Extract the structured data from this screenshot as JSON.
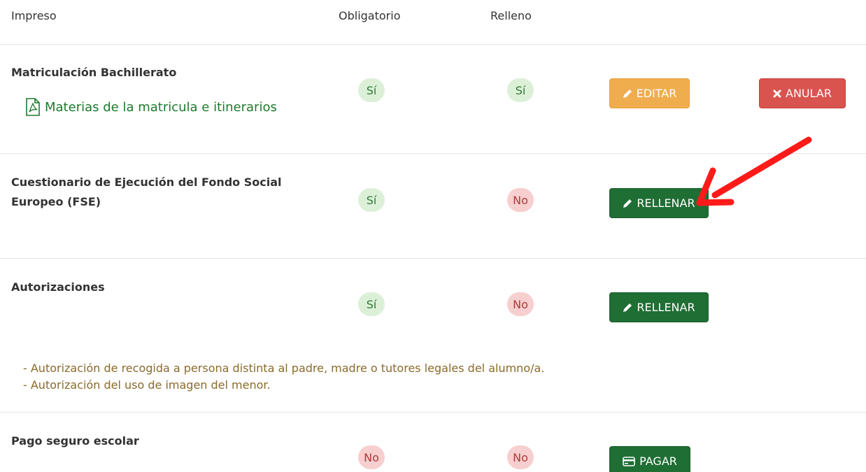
{
  "table": {
    "headers": {
      "impreso": "Impreso",
      "obligatorio": "Obligatorio",
      "relleno": "Relleno"
    },
    "rows": [
      {
        "title": "Matriculación Bachillerato",
        "link": "Materias de la matricula e itinerarios",
        "obligatorio": "Sí",
        "relleno": "Sí",
        "edit_label": "EDITAR",
        "cancel_label": "ANULAR"
      },
      {
        "title": "Cuestionario de Ejecución del Fondo Social Europeo (FSE)",
        "obligatorio": "Sí",
        "relleno": "No",
        "action_label": "RELLENAR"
      },
      {
        "title": "Autorizaciones",
        "obligatorio": "Sí",
        "relleno": "No",
        "action_label": "RELLENAR",
        "notes": [
          "- Autorización de recogida a persona distinta al padre, madre o tutores legales del alumno/a.",
          "- Autorización del uso de imagen del menor."
        ]
      },
      {
        "title": "Pago seguro escolar",
        "obligatorio": "No",
        "relleno": "No",
        "action_label": "PAGAR"
      }
    ]
  },
  "colors": {
    "yes_badge": "#dcf0d8",
    "no_badge": "#f7cfcf",
    "edit_button": "#f0ad4e",
    "cancel_button": "#d9534f",
    "fill_button": "#1f6e34",
    "link": "#1d7a2c",
    "note_text": "#8a6a2a",
    "annotation_arrow": "#ff1a1a"
  },
  "icons": {
    "pdf": "pdf-file-icon",
    "edit": "pencil-icon",
    "cancel": "x-icon",
    "pay": "credit-card-icon",
    "annotation": "red-arrow-annotation"
  }
}
